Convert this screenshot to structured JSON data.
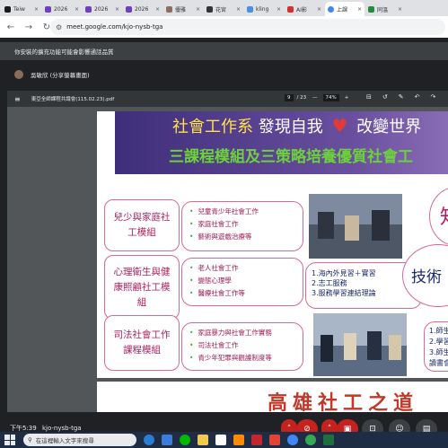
{
  "browser": {
    "tabs": [
      {
        "label": "Teiw",
        "color": "#1a1a1a",
        "active": false
      },
      {
        "label": "2026",
        "color": "#6f3fbf",
        "active": false
      },
      {
        "label": "2026",
        "color": "#6f3fbf",
        "active": false
      },
      {
        "label": "2026",
        "color": "#6f3fbf",
        "active": false
      },
      {
        "label": "優雅",
        "color": "#8d6e63",
        "active": false
      },
      {
        "label": "花宮",
        "color": "#333333",
        "active": false
      },
      {
        "label": "kling",
        "color": "#4a90e2",
        "active": false
      },
      {
        "label": "AI影",
        "color": "#d32f2f",
        "active": false
      },
      {
        "label": "上課",
        "color": "#4285f4",
        "active": true
      },
      {
        "label": "同溫",
        "color": "#1e8e3e",
        "active": false
      }
    ],
    "tab_close": "×",
    "url": "meet.google.com/kjo-nysb-tga"
  },
  "meet": {
    "banner_text": "你安裝的擴充功能可能會影響通話品質",
    "presenter_text": "吳敏欣 (分享螢幕畫面)",
    "pdf": {
      "filename": "東亞全師課程共識會(115.02.23).pdf",
      "page_current": "9",
      "page_total": "/ 23",
      "zoom": "74%",
      "zoom_minus": "—",
      "zoom_plus": "+"
    },
    "time": "下午5:39",
    "meeting_code": "kjo-nysb-tga"
  },
  "slide": {
    "title_part1": "社會工作系",
    "title_part2": "發現自我",
    "title_part3": "改變世界",
    "subtitle": "三課程模組及三策略培養優質社會工",
    "modules": [
      {
        "name": "兒少與家庭社工模組",
        "courses": [
          "兒童青少年社會工作",
          "家庭社會工作",
          "藝術與遊戲治療等"
        ]
      },
      {
        "name": "心理衛生與健康照顧社工模組",
        "courses": [
          "老人社會工作",
          "變態心理學",
          "醫療社會工作等"
        ]
      },
      {
        "name": "司法社會工作課程模組",
        "courses": [
          "家庭暴力與社會工作實務",
          "司法社會工作",
          "青少年犯罪與觀護制度等"
        ]
      }
    ],
    "strategies": [
      "1.海內外見習＋實習",
      "2.志工服務",
      "3.服務學習連結理論"
    ],
    "circle_text_top": "知",
    "circle_text_mid": "技術",
    "right_box_lines": [
      "1.師生",
      "2.學習",
      "3.師生",
      "讀書會"
    ],
    "next_slide_fragment": "高雄社工之道"
  },
  "taskbar": {
    "search_placeholder": "在這裡輸入文字來搜尋"
  },
  "colors": {
    "header_purple": "#4b3a8c",
    "title_yellow": "#ffe14d",
    "subtitle_green": "#6cd13a",
    "module_pink": "#b02060",
    "meet_red": "#c5221f"
  }
}
